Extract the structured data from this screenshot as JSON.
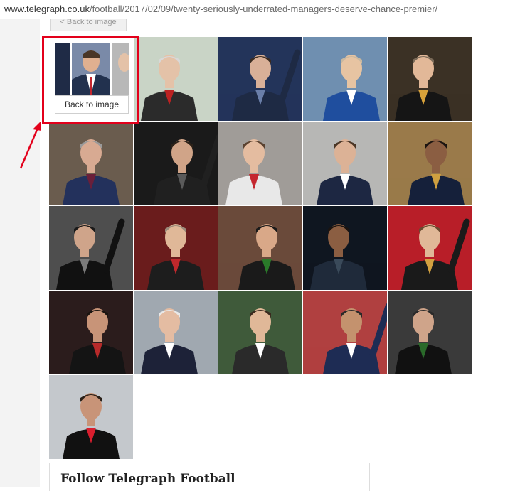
{
  "browser": {
    "url_host": "www.telegraph.co.uk",
    "url_path": "/football/2017/02/09/twenty-seriously-underrated-managers-deserve-chance-premier/"
  },
  "gallery": {
    "top_button_label": "< Back to image",
    "back_to_image_label": "Back to image",
    "colors": {
      "highlight": "#e3001b",
      "arrow": "#e3001b"
    },
    "photos": [
      {
        "bg": "#c9d4c6",
        "skin": "#e4c2a8",
        "hair": "#d8d8d8",
        "body": "#2b2b2b",
        "accent": "#bb2222"
      },
      {
        "bg": "#23345a",
        "skin": "#d9b098",
        "hair": "#3a2c22",
        "body": "#1e2a44",
        "accent": "#6a7ea8"
      },
      {
        "bg": "#6f8fb0",
        "skin": "#e7c4a2",
        "hair": "#c9b8a0",
        "body": "#1f4e9e",
        "accent": "#ffffff"
      },
      {
        "bg": "#3b3125",
        "skin": "#e2b898",
        "hair": "#7a6a58",
        "body": "#151515",
        "accent": "#d8a23a"
      },
      {
        "bg": "#6a5c4e",
        "skin": "#d8aa92",
        "hair": "#9a9a9a",
        "body": "#23315c",
        "accent": "#6a1f3a"
      },
      {
        "bg": "#1a1a1a",
        "skin": "#d0a488",
        "hair": "#2b2118",
        "body": "#202020",
        "accent": "#5a5a5a"
      },
      {
        "bg": "#a09c98",
        "skin": "#e4bca0",
        "hair": "#5a4230",
        "body": "#e8e8e8",
        "accent": "#c4262e"
      },
      {
        "bg": "#b7b7b5",
        "skin": "#dcb296",
        "hair": "#4a3626",
        "body": "#1d2742",
        "accent": "#ffffff"
      },
      {
        "bg": "#9a7a4a",
        "skin": "#8b5e42",
        "hair": "#1b1410",
        "body": "#15203a",
        "accent": "#cfa040"
      },
      {
        "bg": "#4e4e4e",
        "skin": "#cfa48a",
        "hair": "#1a1a1a",
        "body": "#111111",
        "accent": "#7a7a7a"
      },
      {
        "bg": "#6a1c1c",
        "skin": "#e0b898",
        "hair": "#9a8a7a",
        "body": "#1d1d1d",
        "accent": "#c0282c"
      },
      {
        "bg": "#6a4a3a",
        "skin": "#d9a888",
        "hair": "#1a1a1a",
        "body": "#1a1a1a",
        "accent": "#2a7a2a"
      },
      {
        "bg": "#0f1620",
        "skin": "#8b5e42",
        "hair": "#1b1410",
        "body": "#1f2a3a",
        "accent": "#3a4a5a"
      },
      {
        "bg": "#b81e28",
        "skin": "#e0b898",
        "hair": "#6a4a30",
        "body": "#1a1a1a",
        "accent": "#d2a040"
      },
      {
        "bg": "#2b1c1c",
        "skin": "#c89478",
        "hair": "#1a1410",
        "body": "#141414",
        "accent": "#b82a2a"
      },
      {
        "bg": "#a0a8b0",
        "skin": "#e4bca2",
        "hair": "#e8e8e8",
        "body": "#1d2238",
        "accent": "#ffffff"
      },
      {
        "bg": "#3f5a3a",
        "skin": "#e0b898",
        "hair": "#3a2a1e",
        "body": "#2a2a2a",
        "accent": "#ffffff"
      },
      {
        "bg": "#b04040",
        "skin": "#c4926e",
        "hair": "#2a2a2a",
        "body": "#1e2c54",
        "accent": "#ffffff"
      },
      {
        "bg": "#3a3a3a",
        "skin": "#cfa48a",
        "hair": "#2a2a2a",
        "body": "#111111",
        "accent": "#2a6a2a"
      },
      {
        "bg": "#c4c8cc",
        "skin": "#c89478",
        "hair": "#2a2018",
        "body": "#111111",
        "accent": "#d81e2e"
      }
    ]
  },
  "follow": {
    "title": "Follow Telegraph Football"
  }
}
